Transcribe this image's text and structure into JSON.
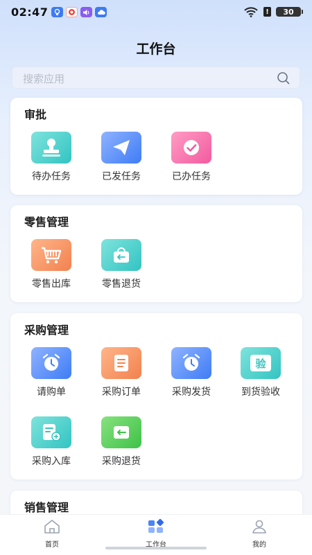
{
  "status_bar": {
    "time": "02:47",
    "battery": "30"
  },
  "header": {
    "title": "工作台"
  },
  "search": {
    "placeholder": "搜索应用"
  },
  "sections": {
    "approval": {
      "title": "审批",
      "items": [
        {
          "label": "待办任务",
          "icon": "stamp-icon",
          "color": "teal"
        },
        {
          "label": "已发任务",
          "icon": "paper-plane-icon",
          "color": "blue"
        },
        {
          "label": "已办任务",
          "icon": "check-circle-icon",
          "color": "pink"
        }
      ]
    },
    "retail": {
      "title": "零售管理",
      "items": [
        {
          "label": "零售出库",
          "icon": "cart-icon",
          "color": "orange"
        },
        {
          "label": "零售退货",
          "icon": "basket-return-icon",
          "color": "teal"
        }
      ]
    },
    "purchase": {
      "title": "采购管理",
      "items": [
        {
          "label": "请购单",
          "icon": "alarm-clock-icon",
          "color": "blue"
        },
        {
          "label": "采购订单",
          "icon": "document-icon",
          "color": "orange"
        },
        {
          "label": "采购发货",
          "icon": "alarm-clock-icon",
          "color": "blue"
        },
        {
          "label": "到货验收",
          "icon": "inspect-badge-icon",
          "badge": "验",
          "color": "teal"
        },
        {
          "label": "采购入库",
          "icon": "inbound-doc-icon",
          "color": "teal"
        },
        {
          "label": "采购退货",
          "icon": "return-box-icon",
          "color": "green"
        }
      ]
    },
    "sales": {
      "title": "销售管理"
    }
  },
  "bottom_nav": [
    {
      "label": "首页",
      "icon": "home-icon"
    },
    {
      "label": "工作台",
      "icon": "workbench-icon",
      "active": true
    },
    {
      "label": "我的",
      "icon": "profile-icon"
    }
  ],
  "colors": {
    "accent": "#3f7cf5",
    "teal": "#32c4c2",
    "pink": "#f25b9f",
    "orange": "#f2814e",
    "green": "#3ec248"
  }
}
